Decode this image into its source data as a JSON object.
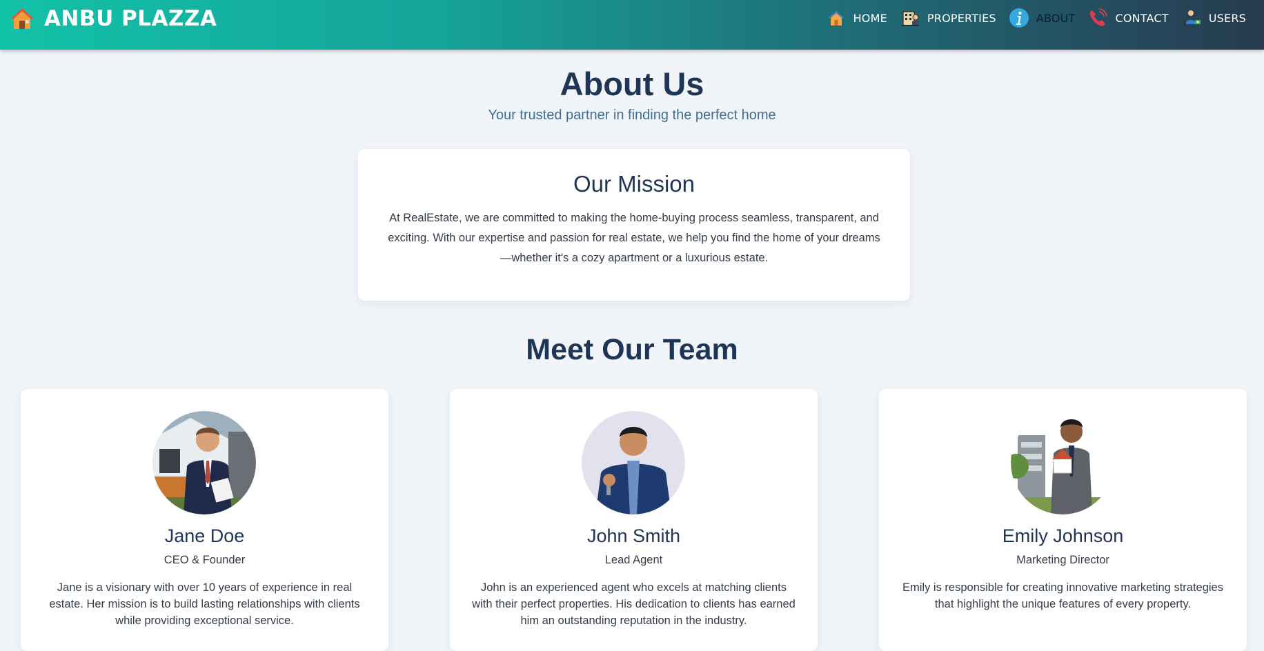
{
  "header": {
    "brand": "ANBU PLAZZA",
    "brand_icon": "house-icon",
    "nav": [
      {
        "label": "HOME",
        "icon": "house-icon"
      },
      {
        "label": "PROPERTIES",
        "icon": "building-icon"
      },
      {
        "label": "ABOUT",
        "icon": "info-icon",
        "active": true
      },
      {
        "label": "CONTACT",
        "icon": "phone-icon"
      },
      {
        "label": "USERS",
        "icon": "user-icon"
      }
    ]
  },
  "about": {
    "title": "About Us",
    "subtitle": "Your trusted partner in finding the perfect home"
  },
  "mission": {
    "title": "Our Mission",
    "text": "At RealEstate, we are committed to making the home-buying process seamless, transparent, and exciting. With our expertise and passion for real estate, we help you find the home of your dreams—whether it's a cozy apartment or a luxurious estate."
  },
  "team": {
    "title": "Meet Our Team",
    "members": [
      {
        "name": "Jane Doe",
        "role": "CEO & Founder",
        "bio": "Jane is a visionary with over 10 years of experience in real estate. Her mission is to build lasting relationships with clients while providing exceptional service."
      },
      {
        "name": "John Smith",
        "role": "Lead Agent",
        "bio": "John is an experienced agent who excels at matching clients with their perfect properties. His dedication to clients has earned him an outstanding reputation in the industry."
      },
      {
        "name": "Emily Johnson",
        "role": "Marketing Director",
        "bio": "Emily is responsible for creating innovative marketing strategies that highlight the unique features of every property."
      }
    ]
  },
  "colors": {
    "header_start": "#12c2a8",
    "header_end": "#273a4f",
    "heading": "#1e3556",
    "subtitle": "#3f6e93",
    "background": "#f1f5f9"
  }
}
